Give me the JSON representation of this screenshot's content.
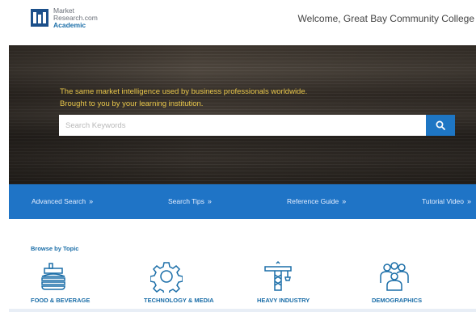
{
  "header": {
    "logo_line1": "Market",
    "logo_line2": "Research.com",
    "logo_line3": "Academic",
    "welcome": "Welcome, Great Bay Community College"
  },
  "hero": {
    "tagline_line1": "The same market intelligence used by business professionals worldwide.",
    "tagline_line2": "Brought to you by your learning institution.",
    "search_placeholder": "Search Keywords",
    "search_icon": "search-icon"
  },
  "nav": {
    "items": [
      {
        "label": "Advanced Search",
        "chevron": "»"
      },
      {
        "label": "Search Tips",
        "chevron": "»"
      },
      {
        "label": "Reference Guide",
        "chevron": "»"
      },
      {
        "label": "Tutorial Video",
        "chevron": "»"
      }
    ]
  },
  "browse": {
    "title": "Browse by Topic",
    "topics": [
      {
        "label": "FOOD & BEVERAGE",
        "icon": "burger-icon"
      },
      {
        "label": "TECHNOLOGY & MEDIA",
        "icon": "gear-icon"
      },
      {
        "label": "HEAVY INDUSTRY",
        "icon": "crane-icon"
      },
      {
        "label": "DEMOGRAPHICS",
        "icon": "people-icon"
      }
    ]
  },
  "colors": {
    "brand_blue": "#1f74c6",
    "link_blue": "#1b6ea8",
    "tagline_gold": "#e8c64a"
  }
}
